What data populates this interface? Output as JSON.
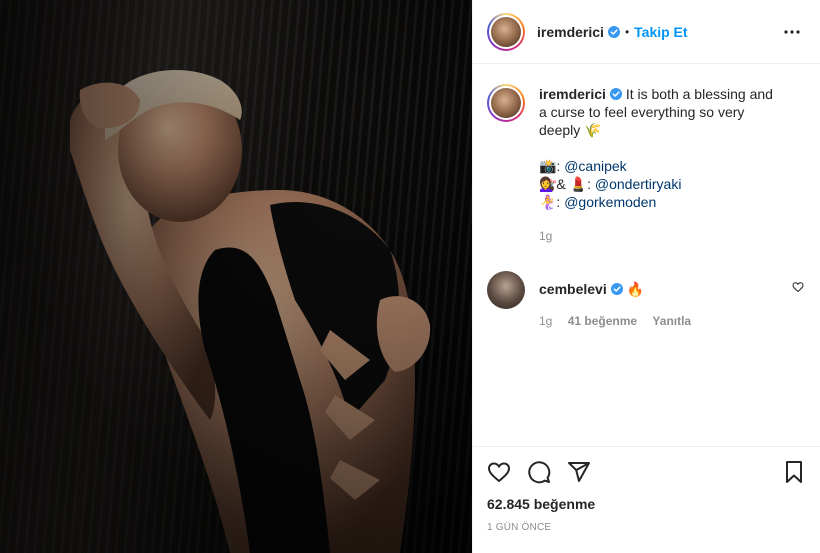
{
  "post": {
    "username": "iremderici",
    "follow_label": "Takip Et",
    "separator": "•",
    "caption": {
      "line1": "It is both a blessing and",
      "line2": "a curse to feel everything so very",
      "line3": "deeply 🌾"
    },
    "credits": [
      {
        "emoji": "📸:",
        "handle": "@canipek"
      },
      {
        "emoji": "💇‍♀️& 💄:",
        "handle": "@ondertiryaki"
      },
      {
        "emoji": "🧜‍♀️:",
        "handle": "@gorkemoden"
      }
    ],
    "caption_time": "1g",
    "comment": {
      "username": "cembelevi",
      "text": "🔥",
      "time": "1g",
      "likes": "41 beğenme",
      "reply": "Yanıtla"
    },
    "likes_count": "62.845 beğenme",
    "posted_ago": "1 GÜN ÖNCE"
  },
  "icons": {
    "verified": "verified-badge-icon",
    "more": "more-options-icon",
    "like": "heart-icon",
    "comment": "comment-icon",
    "share": "share-icon",
    "save": "bookmark-icon"
  },
  "colors": {
    "accent": "#0095f6",
    "text": "#262626",
    "muted": "#8e8e8e",
    "mention": "#00376b"
  }
}
